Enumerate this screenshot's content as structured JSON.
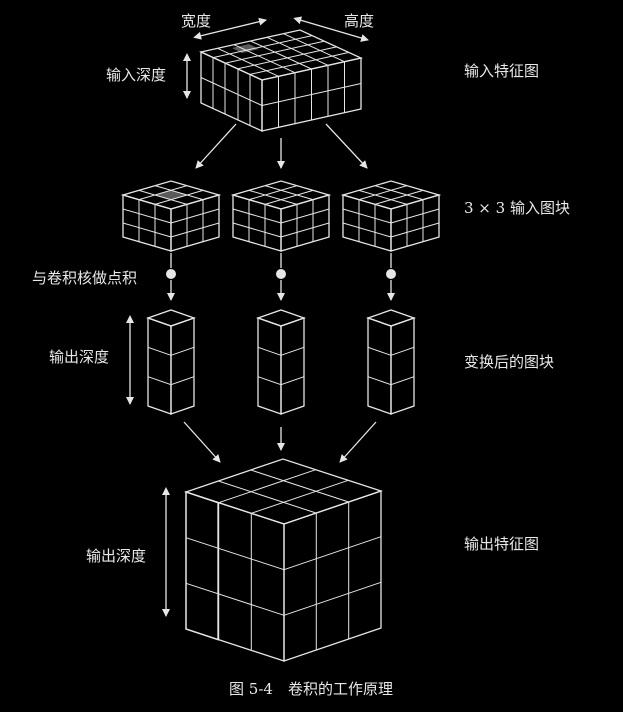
{
  "labels": {
    "width": "宽度",
    "height": "高度",
    "input_depth": "输入深度",
    "input_feature_map": "输入特征图",
    "patch_3x3": "3 × 3 输入图块",
    "dot_product": "与卷积核做点积",
    "output_depth_1": "输出深度",
    "transformed_patches": "变换后的图块",
    "output_depth_2": "输出深度",
    "output_feature_map": "输出特征图"
  },
  "caption": "图 5-4　卷积的工作原理",
  "colors": {
    "background": "#000000",
    "line": "#e6e6e6",
    "face_top": "#2a2a2a",
    "face_front": "#1c1c1c",
    "face_side": "#111111",
    "highlight": "#5a5a5a"
  }
}
